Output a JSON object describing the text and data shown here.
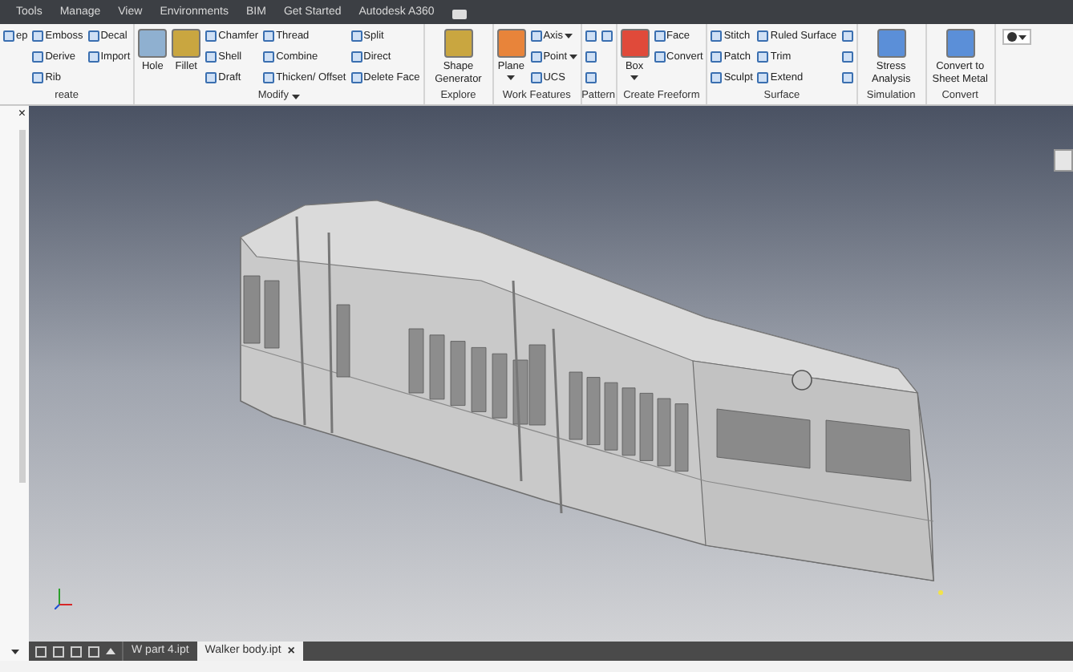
{
  "menu_tabs": [
    "Tools",
    "Manage",
    "View",
    "Environments",
    "BIM",
    "Get Started",
    "Autodesk A360"
  ],
  "ribbon": [
    {
      "title": "reate",
      "menu": false,
      "columns": [
        {
          "kind": "stack",
          "items": [
            {
              "label": "ep",
              "dropdown": false
            }
          ]
        },
        {
          "kind": "stack",
          "items": [
            {
              "label": "Emboss",
              "dropdown": false
            },
            {
              "label": "Derive",
              "dropdown": false
            },
            {
              "label": "Rib",
              "dropdown": false
            }
          ]
        },
        {
          "kind": "stack",
          "items": [
            {
              "label": "Decal",
              "dropdown": false
            },
            {
              "label": "Import",
              "dropdown": false
            }
          ]
        }
      ]
    },
    {
      "title": "Modify",
      "menu": true,
      "columns": [
        {
          "kind": "large",
          "label": "Hole",
          "dropdown": false
        },
        {
          "kind": "large",
          "label": "Fillet",
          "dropdown": false
        },
        {
          "kind": "stack",
          "items": [
            {
              "label": "Chamfer",
              "dropdown": false
            },
            {
              "label": "Shell",
              "dropdown": false
            },
            {
              "label": "Draft",
              "dropdown": false
            }
          ]
        },
        {
          "kind": "stack",
          "items": [
            {
              "label": "Thread",
              "dropdown": false
            },
            {
              "label": "Combine",
              "dropdown": false
            },
            {
              "label": "Thicken/ Offset",
              "dropdown": false
            }
          ]
        },
        {
          "kind": "stack",
          "items": [
            {
              "label": "Split",
              "dropdown": false
            },
            {
              "label": "Direct",
              "dropdown": false
            },
            {
              "label": "Delete Face",
              "dropdown": false
            }
          ]
        }
      ]
    },
    {
      "title": "Explore",
      "menu": false,
      "columns": [
        {
          "kind": "large",
          "label": "Shape Generator",
          "dropdown": false
        }
      ]
    },
    {
      "title": "Work Features",
      "menu": false,
      "columns": [
        {
          "kind": "large",
          "label": "Plane",
          "dropdown": true
        },
        {
          "kind": "stack",
          "items": [
            {
              "label": "Axis",
              "dropdown": true
            },
            {
              "label": "Point",
              "dropdown": true
            },
            {
              "label": "UCS",
              "dropdown": false
            }
          ]
        }
      ]
    },
    {
      "title": "Pattern",
      "menu": false,
      "columns": [
        {
          "kind": "stack",
          "items": [
            {
              "dropdown": false
            },
            {
              "dropdown": false
            },
            {
              "dropdown": false
            }
          ]
        },
        {
          "kind": "stack",
          "items": [
            {
              "dropdown": false
            }
          ]
        }
      ]
    },
    {
      "title": "Create Freeform",
      "menu": false,
      "columns": [
        {
          "kind": "large",
          "label": "Box",
          "dropdown": true
        },
        {
          "kind": "stack",
          "items": [
            {
              "label": "Face",
              "dropdown": false
            },
            {
              "label": "Convert",
              "dropdown": false
            }
          ]
        }
      ]
    },
    {
      "title": "Surface",
      "menu": false,
      "columns": [
        {
          "kind": "stack",
          "items": [
            {
              "label": "Stitch",
              "dropdown": false
            },
            {
              "label": "Patch",
              "dropdown": false
            },
            {
              "label": "Sculpt",
              "dropdown": false
            }
          ]
        },
        {
          "kind": "stack",
          "items": [
            {
              "label": "Ruled Surface",
              "dropdown": false
            },
            {
              "label": "Trim",
              "dropdown": false
            },
            {
              "label": "Extend",
              "dropdown": false
            }
          ]
        },
        {
          "kind": "stack",
          "items": [
            {
              "dropdown": false
            },
            {
              "dropdown": false
            },
            {
              "dropdown": false
            }
          ]
        }
      ]
    },
    {
      "title": "Simulation",
      "menu": false,
      "columns": [
        {
          "kind": "large",
          "label": "Stress Analysis",
          "dropdown": false
        }
      ]
    },
    {
      "title": "Convert",
      "menu": false,
      "columns": [
        {
          "kind": "large",
          "label": "Convert to Sheet Metal",
          "dropdown": false
        }
      ]
    }
  ],
  "browser_close": "×",
  "document_tabs": [
    {
      "label": "W part 4.ipt",
      "selected": false
    },
    {
      "label": "Walker body.ipt",
      "selected": true
    }
  ],
  "tab_close": "×"
}
